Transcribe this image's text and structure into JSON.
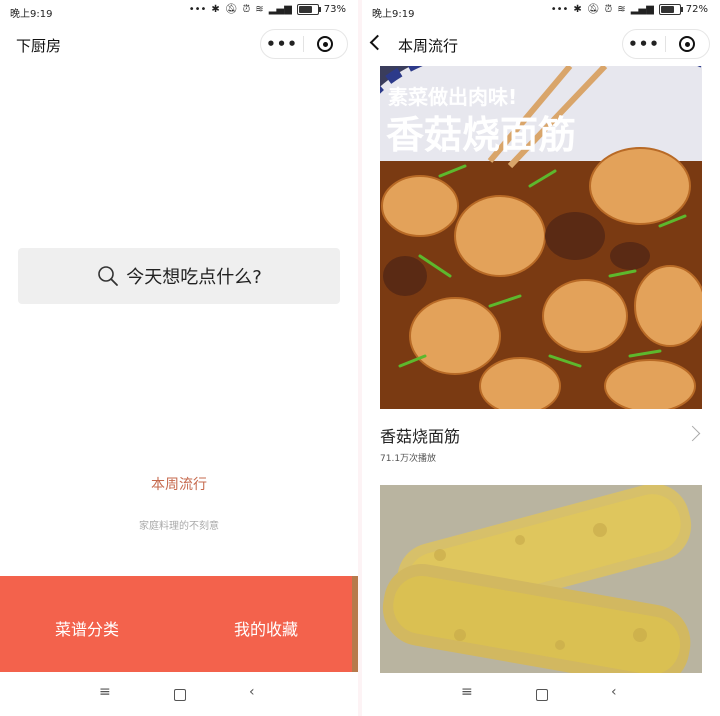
{
  "left": {
    "status": {
      "time": "晚上9:19",
      "battery": "73%",
      "battery_level": 0.73
    },
    "nav": {
      "title": "下厨房"
    },
    "search": {
      "placeholder": "今天想吃点什么?"
    },
    "weekly_link": "本周流行",
    "tagline": "家庭料理的不刻意",
    "bottom": {
      "category_label": "菜谱分类",
      "favorites_label": "我的收藏"
    }
  },
  "right": {
    "status": {
      "time": "晚上9:19",
      "battery": "72%",
      "battery_level": 0.72
    },
    "nav": {
      "title": "本周流行"
    },
    "recipes": [
      {
        "title": "香菇烧面筋",
        "plays": "71.1万次播放",
        "overlay_caption": "素菜做出肉味!",
        "overlay_title": "香菇烧面筋"
      },
      {
        "title": "",
        "plays": ""
      }
    ]
  },
  "capsule": {
    "more_icon": "more-dots-icon",
    "target_icon": "target-icon"
  },
  "colors": {
    "accent": "#f3624c",
    "link": "#c66a4e",
    "search_bg": "#efefef"
  }
}
